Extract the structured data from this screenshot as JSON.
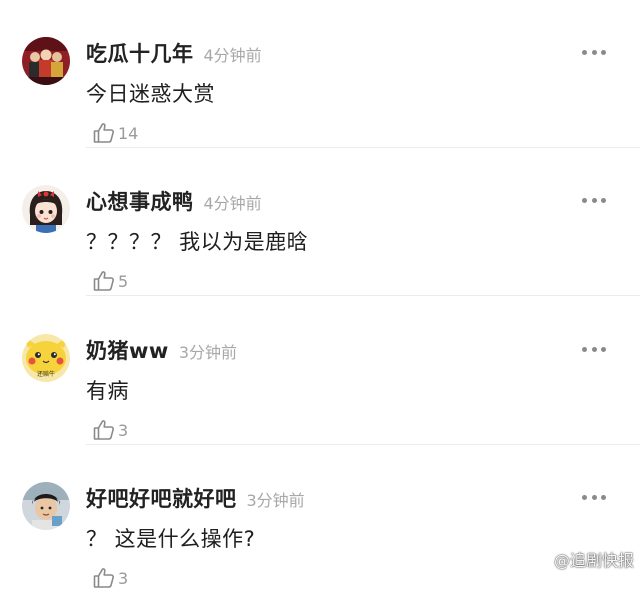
{
  "comments": [
    {
      "username": "吃瓜十几年",
      "time": "4分钟前",
      "text": "今日迷惑大赏",
      "likes": "14",
      "avatar_icon": "crowd-avatar-icon"
    },
    {
      "username": "心想事成鸭",
      "time": "4分钟前",
      "text": "？？？？ 我以为是鹿晗",
      "likes": "5",
      "avatar_icon": "cartoon-girl-avatar-icon"
    },
    {
      "username": "奶猪ww",
      "time": "3分钟前",
      "text": "有病",
      "likes": "3",
      "avatar_icon": "pikachu-avatar-icon",
      "avatar_caption": "还赔牛"
    },
    {
      "username": "好吧好吧就好吧",
      "time": "3分钟前",
      "text": "？ 这是什么操作?",
      "likes": "3",
      "avatar_icon": "boy-photo-avatar-icon"
    }
  ],
  "watermark": {
    "text": "@追剧快报",
    "icon": "weibo-logo-icon"
  },
  "colors": {
    "username": "#222222",
    "timestamp": "#a8a8a8",
    "divider": "#ececec",
    "icon_gray": "#8a8a8a"
  }
}
